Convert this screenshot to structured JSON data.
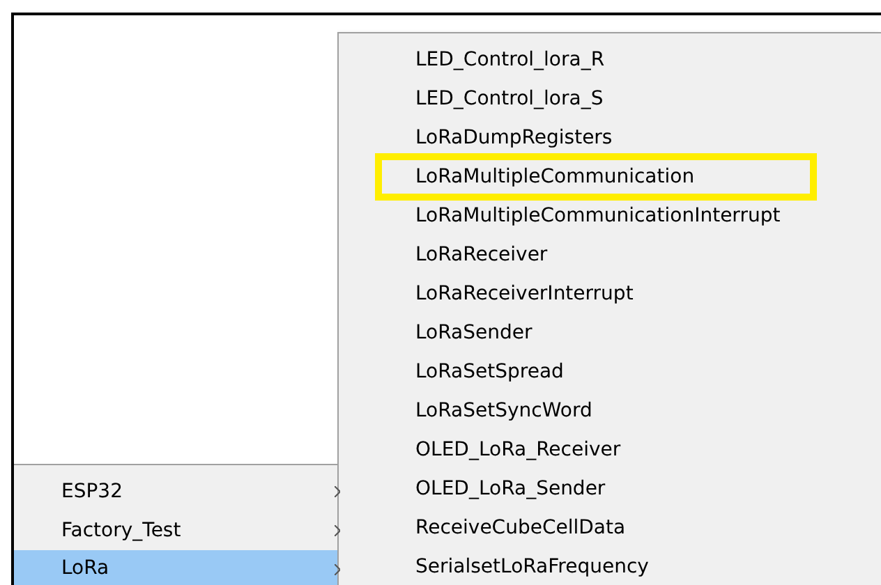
{
  "menu": {
    "items": [
      {
        "label": "ESP32",
        "selected": false
      },
      {
        "label": "Factory_Test",
        "selected": false
      },
      {
        "label": "LoRa",
        "selected": true
      }
    ]
  },
  "submenu": {
    "items": [
      {
        "label": "LED_Control_lora_R",
        "highlighted": false
      },
      {
        "label": "LED_Control_lora_S",
        "highlighted": false
      },
      {
        "label": "LoRaDumpRegisters",
        "highlighted": false
      },
      {
        "label": "LoRaMultipleCommunication",
        "highlighted": true
      },
      {
        "label": "LoRaMultipleCommunicationInterrupt",
        "highlighted": false
      },
      {
        "label": "LoRaReceiver",
        "highlighted": false
      },
      {
        "label": "LoRaReceiverInterrupt",
        "highlighted": false
      },
      {
        "label": "LoRaSender",
        "highlighted": false
      },
      {
        "label": "LoRaSetSpread",
        "highlighted": false
      },
      {
        "label": "LoRaSetSyncWord",
        "highlighted": false
      },
      {
        "label": "OLED_LoRa_Receiver",
        "highlighted": false
      },
      {
        "label": "OLED_LoRa_Sender",
        "highlighted": false
      },
      {
        "label": "ReceiveCubeCellData",
        "highlighted": false
      },
      {
        "label": "SerialsetLoRaFrequency",
        "highlighted": false
      }
    ]
  }
}
